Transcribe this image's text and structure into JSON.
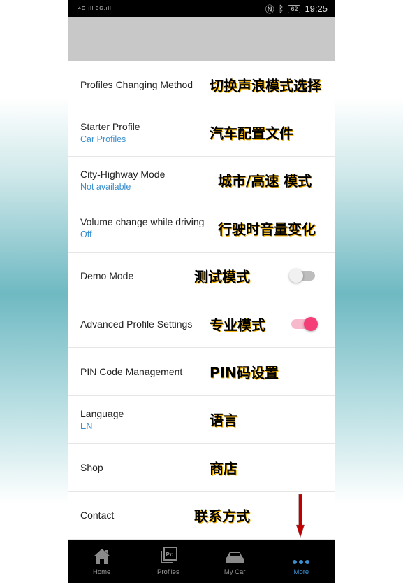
{
  "status_bar": {
    "signal_left": "4G",
    "signal_right": "3G",
    "battery": "62",
    "time": "19:25"
  },
  "settings": [
    {
      "label": "Profiles Changing Method",
      "value": null,
      "annotation": "切换声浪模式选择"
    },
    {
      "label": "Starter Profile",
      "value": "Car Profiles",
      "annotation": "汽车配置文件"
    },
    {
      "label": "City-Highway Mode",
      "value": "Not available",
      "annotation": "城市/高速 模式"
    },
    {
      "label": "Volume change while driving",
      "value": "Off",
      "annotation": "行驶时音量变化"
    },
    {
      "label": "Demo Mode",
      "value": null,
      "annotation": "测试模式",
      "toggle": false
    },
    {
      "label": "Advanced Profile Settings",
      "value": null,
      "annotation": "专业模式",
      "toggle": true
    },
    {
      "label": "PIN Code Management",
      "value": null,
      "annotation": "PIN码设置"
    },
    {
      "label": "Language",
      "value": "EN",
      "annotation": "语言"
    },
    {
      "label": "Shop",
      "value": null,
      "annotation": "商店"
    },
    {
      "label": "Contact",
      "value": null,
      "annotation": "联系方式"
    }
  ],
  "nav": [
    {
      "label": "Home",
      "icon": "home-icon"
    },
    {
      "label": "Profiles",
      "icon": "profiles-icon"
    },
    {
      "label": "My Car",
      "icon": "car-icon"
    },
    {
      "label": "More",
      "icon": "more-dots-icon",
      "active": true
    }
  ],
  "colors": {
    "accent": "#3a8fd0",
    "toggle_on": "#f53d78",
    "arrow": "#c00000"
  }
}
